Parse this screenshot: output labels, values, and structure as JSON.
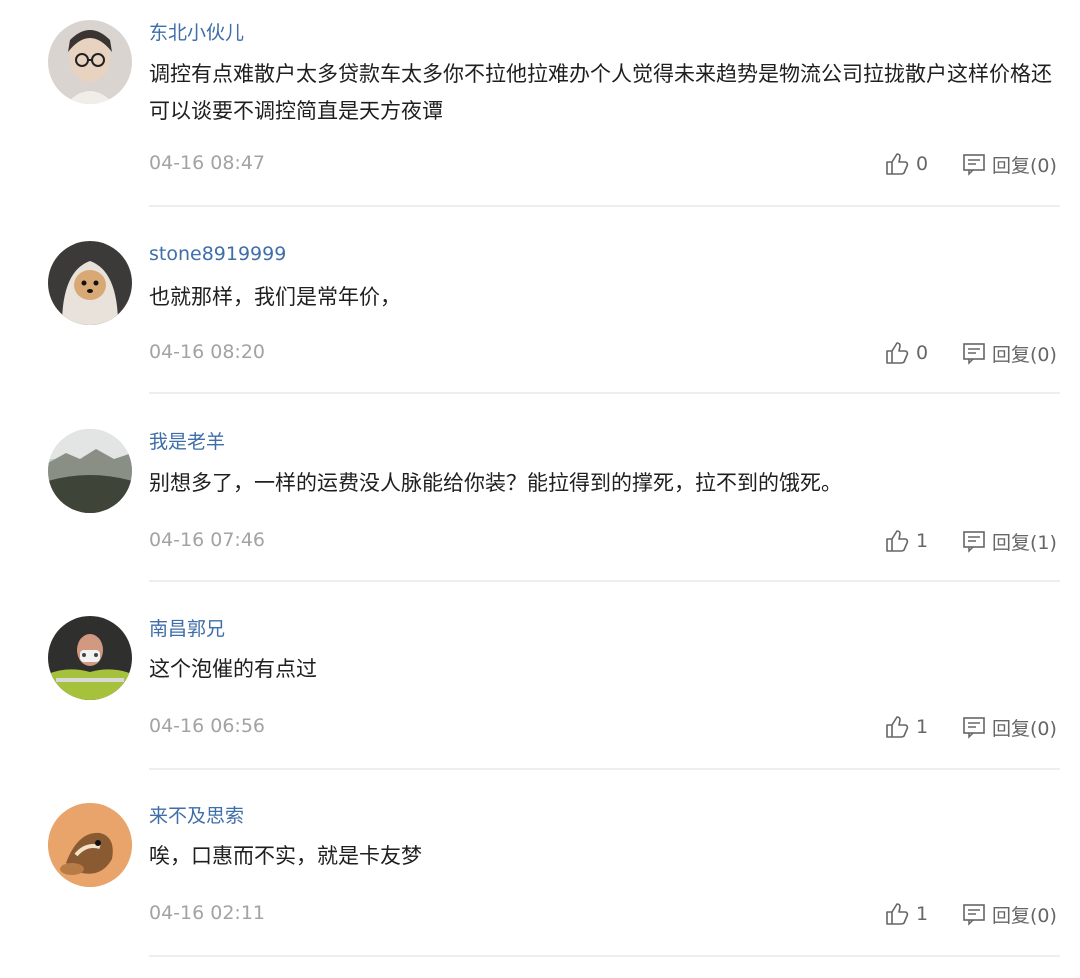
{
  "comments": [
    {
      "username": "东北小伙儿",
      "content": "调控有点难散户太多贷款车太多你不拉他拉难办个人觉得未来趋势是物流公司拉拢散户这样价格还可以谈要不调控简直是天方夜谭",
      "time": "04-16 08:47",
      "likes": "0",
      "reply": "回复(0)",
      "avatar_icon": "young-man-avatar"
    },
    {
      "username": "stone8919999",
      "content": "也就那样，我们是常年价，",
      "time": "04-16 08:20",
      "likes": "0",
      "reply": "回复(0)",
      "avatar_icon": "dog-avatar"
    },
    {
      "username": "我是老羊",
      "content": "别想多了，一样的运费没人脉能给你装？能拉得到的撑死，拉不到的饿死。",
      "time": "04-16 07:46",
      "likes": "1",
      "reply": "回复(1)",
      "avatar_icon": "landscape-avatar"
    },
    {
      "username": "南昌郭兄",
      "content": "这个泡催的有点过",
      "time": "04-16 06:56",
      "likes": "1",
      "reply": "回复(0)",
      "avatar_icon": "masked-worker-avatar"
    },
    {
      "username": "来不及思索",
      "content": "唉，口惠而不实，就是卡友梦",
      "time": "04-16 02:11",
      "likes": "1",
      "reply": "回复(0)",
      "avatar_icon": "chipmunk-avatar"
    }
  ],
  "colors": {
    "username": "#3f6ea8",
    "content": "#1f1f1f",
    "time": "#a3a3a3",
    "action": "#666666",
    "divider": "#eeeeee"
  }
}
